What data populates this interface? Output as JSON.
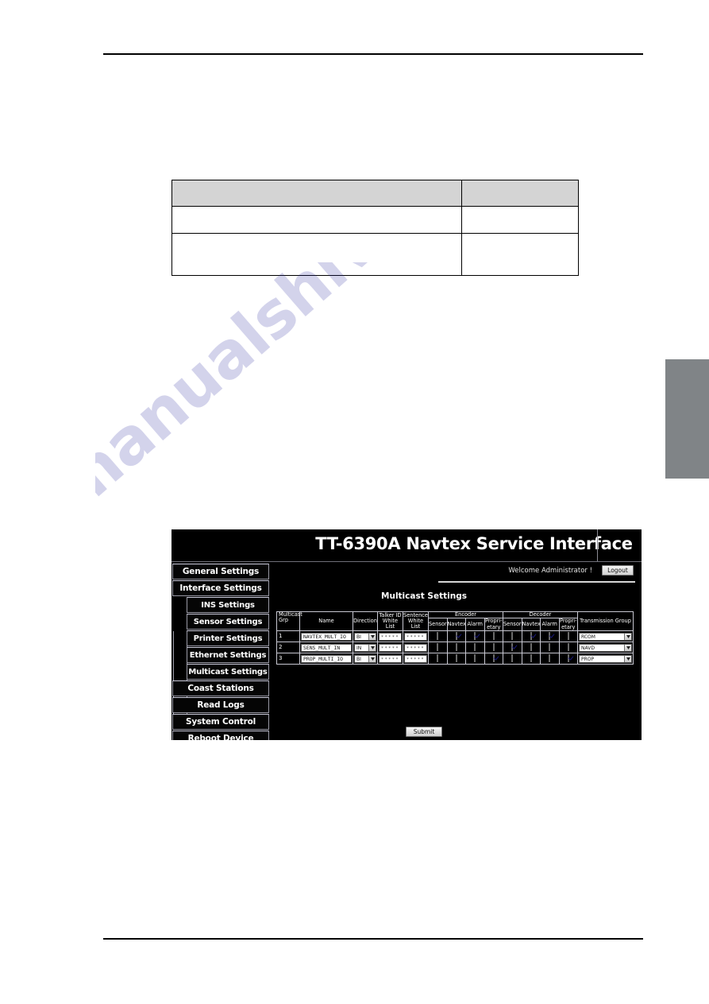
{
  "document": {
    "table": {
      "header_cells": [
        "",
        ""
      ],
      "rows": [
        [
          "",
          ""
        ],
        [
          "",
          ""
        ]
      ]
    },
    "watermark": "manualshive.com"
  },
  "webui": {
    "banner_title": "TT-6390A Navtex Service Interface",
    "welcome_text": "Welcome Administrator !",
    "logout_label": "Logout",
    "page_heading": "Multicast Settings",
    "submit_label": "Submit",
    "sidebar": {
      "items": [
        {
          "label": "General Settings",
          "level": 0
        },
        {
          "label": "Interface Settings",
          "level": 0
        },
        {
          "label": "INS Settings",
          "level": 1
        },
        {
          "label": "Sensor Settings",
          "level": 1
        },
        {
          "label": "Printer Settings",
          "level": 1
        },
        {
          "label": "Ethernet Settings",
          "level": 1
        },
        {
          "label": "Multicast Settings",
          "level": 1
        },
        {
          "label": "Coast Stations",
          "level": 0
        },
        {
          "label": "Read Logs",
          "level": 0
        },
        {
          "label": "System Control",
          "level": 0
        },
        {
          "label": "Reboot Device",
          "level": 0
        }
      ]
    },
    "table": {
      "group_headers": [
        {
          "label": "Encoder",
          "span": 4
        },
        {
          "label": "Decoder",
          "span": 4
        }
      ],
      "headers": {
        "multicast_grp": "Multicast Grp",
        "name": "Name",
        "direction": "Direction",
        "talker_id_white_list": "Talker ID White List",
        "sentence_white_list": "Sentence White List",
        "encoder": "Encoder",
        "decoder": "Decoder",
        "sensor": "Sensor",
        "navtex": "Navtex",
        "alarm": "Alarm",
        "proprietary": "Propri-etary",
        "transmission_group": "Transmission Group"
      },
      "mask_value": "*****",
      "rows": [
        {
          "grp": "1",
          "name": "NAVTEX_MULT_IO",
          "direction": "BI",
          "talker_id_white_list": "*****",
          "sentence_white_list": "*****",
          "encoder": {
            "sensor": false,
            "navtex": true,
            "alarm": true,
            "proprietary": false
          },
          "decoder": {
            "sensor": false,
            "navtex": true,
            "alarm": true,
            "proprietary": false
          },
          "transmission_group": "RCOM"
        },
        {
          "grp": "2",
          "name": "SENS_MULT_IN",
          "direction": "IN",
          "talker_id_white_list": "*****",
          "sentence_white_list": "*****",
          "encoder": {
            "sensor": false,
            "navtex": false,
            "alarm": false,
            "proprietary": false
          },
          "decoder": {
            "sensor": true,
            "navtex": false,
            "alarm": false,
            "proprietary": false
          },
          "transmission_group": "NAVD"
        },
        {
          "grp": "3",
          "name": "PROP_MULTI_IO",
          "direction": "BI",
          "talker_id_white_list": "*****",
          "sentence_white_list": "*****",
          "encoder": {
            "sensor": false,
            "navtex": false,
            "alarm": false,
            "proprietary": true
          },
          "decoder": {
            "sensor": false,
            "navtex": false,
            "alarm": false,
            "proprietary": true
          },
          "transmission_group": "PROP"
        }
      ]
    }
  },
  "colors": {
    "panel_background": "#000000",
    "panel_text": "#ffffff",
    "page_background": "#ffffff",
    "doc_table_header_fill": "#d4d4d4",
    "rule": "#000000",
    "side_tab": "#808487",
    "watermark": "#2a2a9e",
    "checkbox_tick": "#1b1b7a"
  }
}
